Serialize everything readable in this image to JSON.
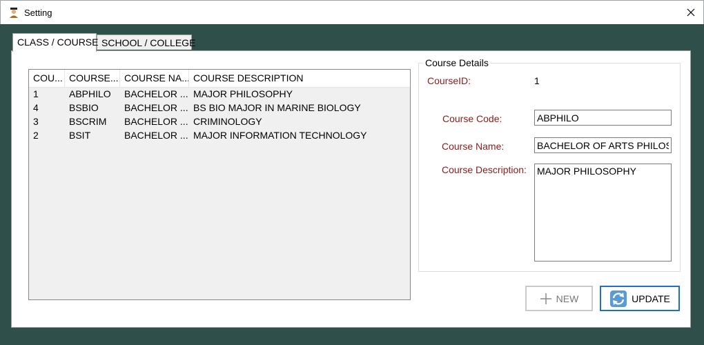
{
  "window": {
    "title": "Setting",
    "icon": "student-graduate-icon",
    "close_icon": "close-icon"
  },
  "tabs": [
    {
      "label": "CLASS / COURSE",
      "active": true
    },
    {
      "label": "SCHOOL / COLLEGE",
      "active": false
    }
  ],
  "course_list": {
    "columns": [
      "COU...",
      "COURSE...",
      "COURSE NA...",
      "COURSE DESCRIPTION"
    ],
    "rows": [
      [
        "1",
        "ABPHILO",
        "BACHELOR ...",
        "MAJOR PHILOSOPHY"
      ],
      [
        "4",
        "BSBIO",
        "BACHELOR ...",
        "BS BIO MAJOR IN MARINE BIOLOGY"
      ],
      [
        "3",
        "BSCRIM",
        "BACHELOR ...",
        "CRIMINOLOGY"
      ],
      [
        "2",
        "BSIT",
        "BACHELOR ...",
        "MAJOR INFORMATION TECHNOLOGY"
      ]
    ]
  },
  "details": {
    "group_title": "Course Details",
    "course_id_label": "CourseID:",
    "course_id_value": "1",
    "course_code_label": "Course Code:",
    "course_code_value": "ABPHILO",
    "course_name_label": "Course Name:",
    "course_name_value": "BACHELOR OF ARTS PHILOSOPHY",
    "course_description_label": "Course Description:",
    "course_description_value": "MAJOR PHILOSOPHY"
  },
  "buttons": {
    "new_label": "NEW",
    "new_icon": "plus-icon",
    "update_label": "UPDATE",
    "update_icon": "refresh-icon"
  },
  "colors": {
    "background": "#2f4f4a",
    "label_text": "#8b1a1a",
    "update_border": "#1e6fc8"
  }
}
